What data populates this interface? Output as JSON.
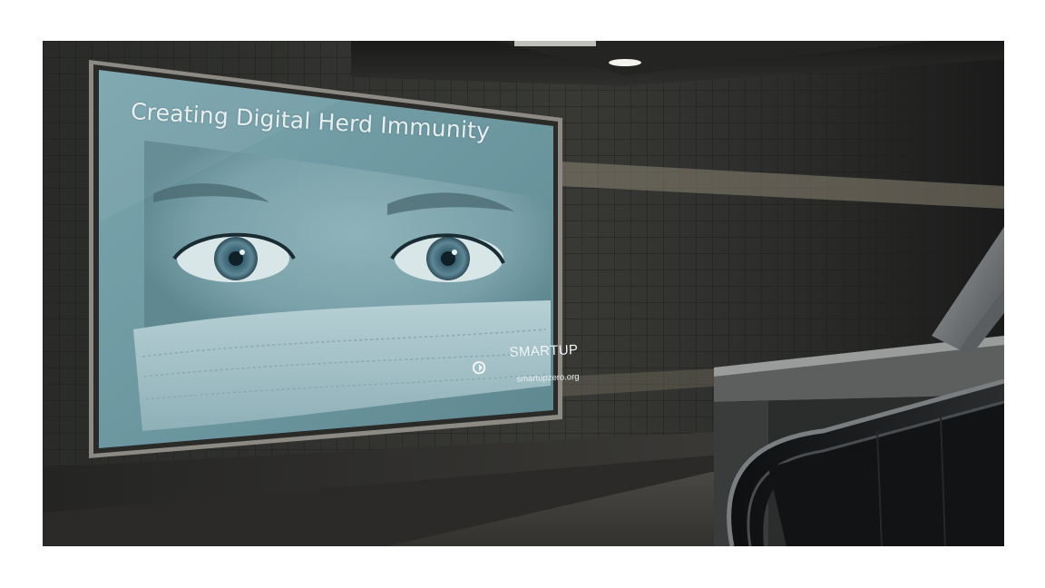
{
  "billboard": {
    "headline": "Creating Digital Herd Immunity",
    "brand_name": "SMARTUP",
    "brand_url": "smartupzero.org"
  },
  "scene": {
    "setting": "subway-station-corridor",
    "colors": {
      "tile": "#2c2e2c",
      "poster_tint": "#6f9aa4",
      "frame": "#8d8a84",
      "floor": "#3a3836"
    }
  }
}
